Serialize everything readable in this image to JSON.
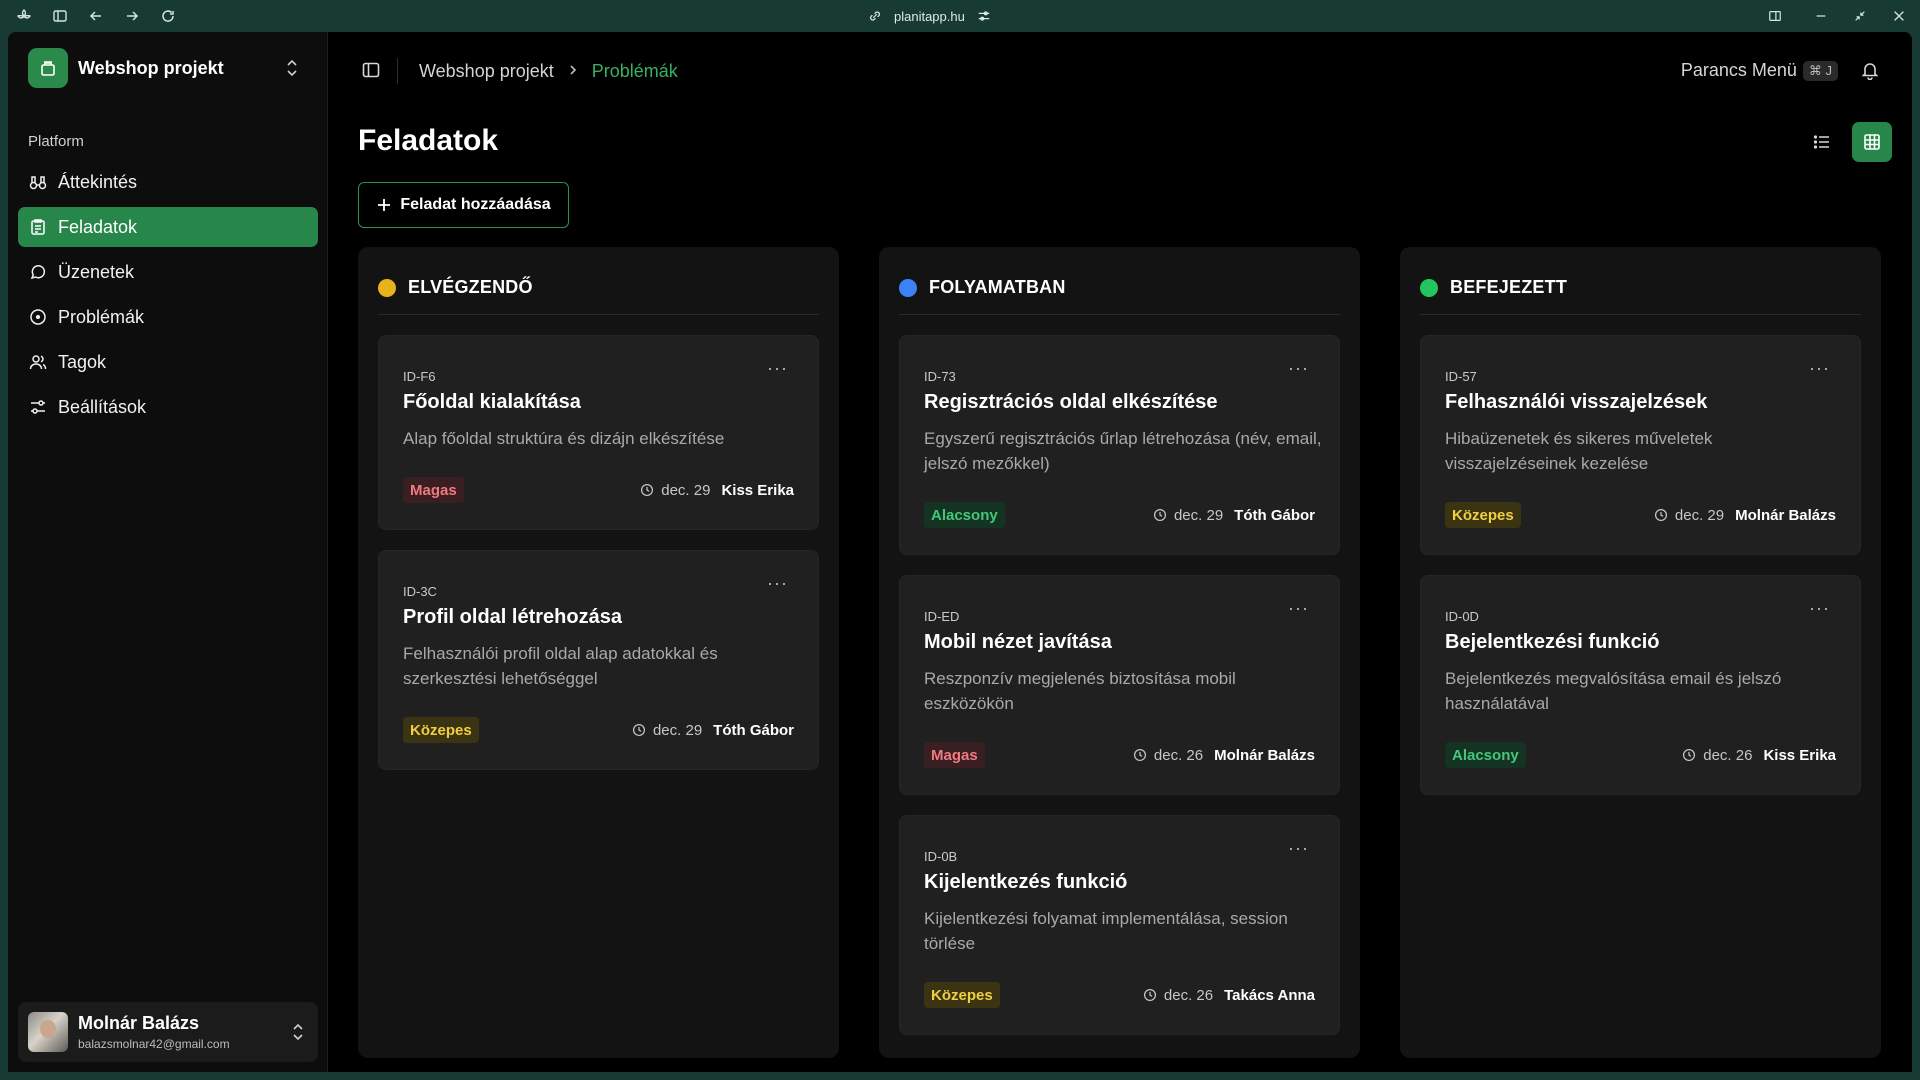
{
  "browser": {
    "url": "planitapp.hu"
  },
  "sidebar": {
    "project_name": "Webshop projekt",
    "section_label": "Platform",
    "items": [
      {
        "label": "Áttekintés"
      },
      {
        "label": "Feladatok"
      },
      {
        "label": "Üzenetek"
      },
      {
        "label": "Problémák"
      },
      {
        "label": "Tagok"
      },
      {
        "label": "Beállítások"
      }
    ],
    "active_item": "Feladatok",
    "user": {
      "name": "Molnár Balázs",
      "email": "balazsmolnar42@gmail.com"
    }
  },
  "header": {
    "breadcrumb": [
      "Webshop projekt",
      "Problémák"
    ],
    "command_menu_label": "Parancs Menü",
    "command_shortcut": "⌘ J"
  },
  "main": {
    "title": "Feladatok",
    "add_button_label": "Feladat hozzáadása"
  },
  "colors": {
    "accent": "#27874a",
    "todo": "#e8b21a",
    "in_progress": "#3b82f6",
    "done": "#22c55e"
  },
  "columns": [
    {
      "title": "ELVÉGZENDŐ",
      "cards": [
        {
          "id": "ID-F6",
          "title": "Főoldal kialakítása",
          "description": "Alap főoldal struktúra és dizájn elkészítése",
          "priority": "Magas",
          "date": "dec. 29",
          "assignee": "Kiss Erika"
        },
        {
          "id": "ID-3C",
          "title": "Profil oldal létrehozása",
          "description": "Felhasználói profil oldal alap adatokkal és szerkesztési lehetőséggel",
          "priority": "Közepes",
          "date": "dec. 29",
          "assignee": "Tóth Gábor"
        }
      ]
    },
    {
      "title": "FOLYAMATBAN",
      "cards": [
        {
          "id": "ID-73",
          "title": "Regisztrációs oldal elkészítése",
          "description": "Egyszerű regisztrációs űrlap létrehozása (név, email, jelszó mezőkkel)",
          "priority": "Alacsony",
          "date": "dec. 29",
          "assignee": "Tóth Gábor"
        },
        {
          "id": "ID-ED",
          "title": "Mobil nézet javítása",
          "description": "Reszponzív megjelenés biztosítása mobil eszközökön",
          "priority": "Magas",
          "date": "dec. 26",
          "assignee": "Molnár Balázs"
        },
        {
          "id": "ID-0B",
          "title": "Kijelentkezés funkció",
          "description": "Kijelentkezési folyamat implementálása, session törlése",
          "priority": "Közepes",
          "date": "dec. 26",
          "assignee": "Takács Anna"
        }
      ]
    },
    {
      "title": "BEFEJEZETT",
      "cards": [
        {
          "id": "ID-57",
          "title": "Felhasználói visszajelzések",
          "description": "Hibaüzenetek és sikeres műveletek visszajelzéseinek kezelése",
          "priority": "Közepes",
          "date": "dec. 29",
          "assignee": "Molnár Balázs"
        },
        {
          "id": "ID-0D",
          "title": "Bejelentkezési funkció",
          "description": "Bejelentkezés megvalósítása email és jelszó használatával",
          "priority": "Alacsony",
          "date": "dec. 26",
          "assignee": "Kiss Erika"
        }
      ]
    }
  ]
}
